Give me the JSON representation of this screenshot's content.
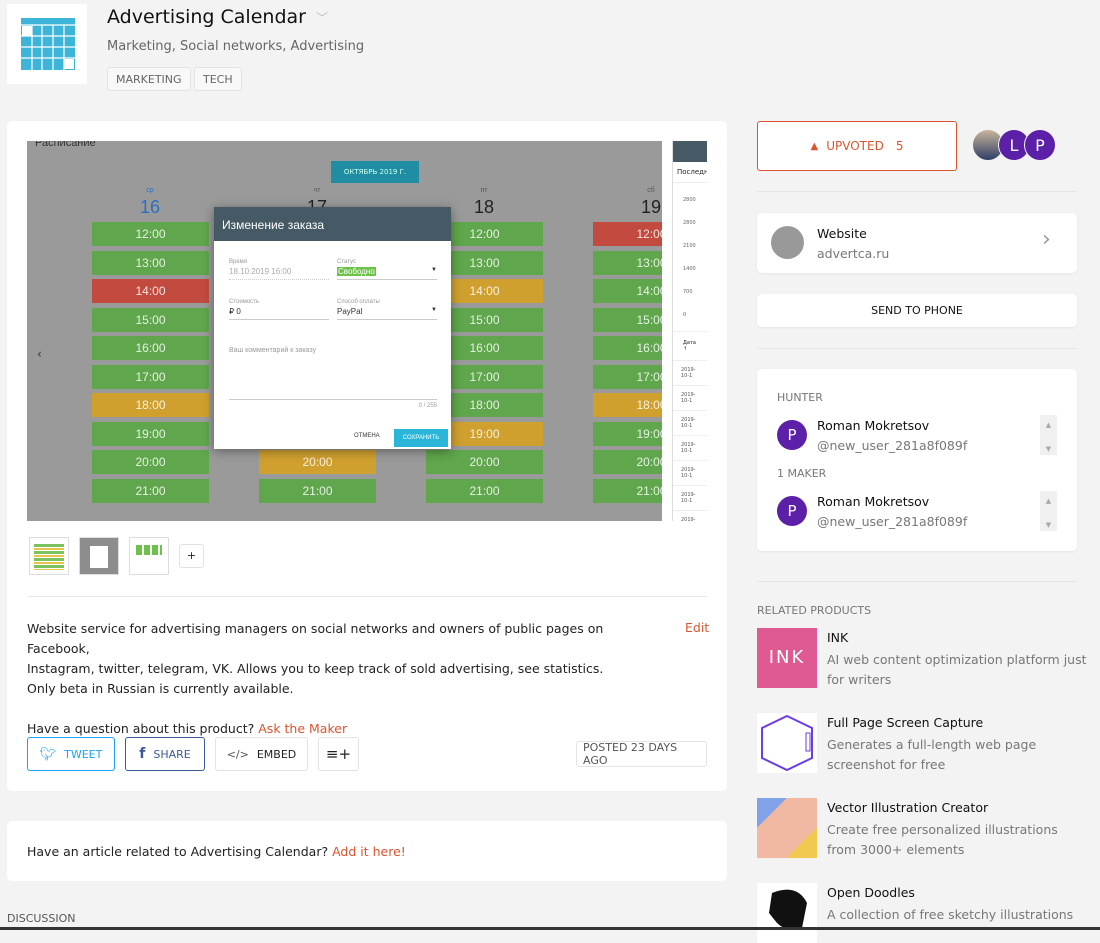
{
  "product": {
    "name": "Advertising Calendar",
    "categories": "Marketing, Social networks, Advertising",
    "tags": [
      "MARKETING",
      "TECH"
    ]
  },
  "gallery": {
    "heading": "Расписание",
    "month_button": "ОКТЯБРЬ 2019 Г.",
    "prev_arrow": "‹",
    "days": [
      {
        "name": "ср",
        "num": "16",
        "slots": [
          "green",
          "green",
          "red",
          "green",
          "green",
          "green",
          "yellow",
          "green",
          "green",
          "green"
        ]
      },
      {
        "name": "чт",
        "num": "17",
        "slots": [
          "green",
          "green",
          "green",
          "green",
          "green",
          "green",
          "green",
          "green",
          "yellow",
          "green"
        ]
      },
      {
        "name": "пт",
        "num": "18",
        "slots": [
          "green",
          "green",
          "yellow",
          "green",
          "green",
          "green",
          "green",
          "yellow",
          "green",
          "green"
        ]
      },
      {
        "name": "сб",
        "num": "19",
        "slots": [
          "red",
          "green",
          "green",
          "green",
          "green",
          "green",
          "yellow",
          "green",
          "green",
          "green"
        ]
      }
    ],
    "times": [
      "12:00",
      "13:00",
      "14:00",
      "15:00",
      "16:00",
      "17:00",
      "18:00",
      "19:00",
      "20:00",
      "21:00"
    ],
    "slot_colors": {
      "green": "#5fa64c",
      "red": "#c34a3f",
      "yellow": "#cfa02e"
    },
    "modal": {
      "title": "Изменение заказа",
      "time_label": "Время",
      "time_value": "18.10.2019 16:00",
      "status_label": "Статус",
      "status_value": "Свободно",
      "cost_label": "Стоимость",
      "cost_value": "₽ 0",
      "payment_label": "Способ оплаты",
      "payment_value": "PayPal",
      "comment_placeholder": "Ваш комментарий к заказу",
      "counter": "0 / 255",
      "cancel": "ОТМЕНА",
      "save": "СОХРАНИТЬ"
    },
    "side": {
      "tab": "Последн",
      "axis": [
        "2800",
        "2800",
        "2100",
        "1400",
        "700",
        "0"
      ],
      "col": "Дата ↑",
      "rows": [
        "2019-10-1",
        "2019-10-1",
        "2019-10-1",
        "2019-10-1",
        "2019-10-1",
        "2019-10-1",
        "2019-10-1"
      ]
    },
    "add_button": "+"
  },
  "description": {
    "text_lines": [
      "Website service for advertising managers on social networks and owners of public pages on Facebook,",
      "Instagram, twitter, telegram, VK. Allows you to keep track of sold advertising, see statistics.",
      "Only beta in Russian is currently available."
    ],
    "edit": "Edit",
    "question": "Have a question about this product?",
    "ask": "Ask the Maker"
  },
  "actions": {
    "tweet": "TWEET",
    "share": "SHARE",
    "embed": "EMBED",
    "posted": "POSTED 23 DAYS AGO"
  },
  "article": {
    "text": "Have an article related to Advertising Calendar?",
    "link": "Add it here!"
  },
  "discussion": "DISCUSSION",
  "sidebar": {
    "upvote_label": "UPVOTED",
    "upvote_count": "5",
    "voters": [
      "L",
      "P"
    ],
    "website": {
      "label": "Website",
      "url": "advertca.ru"
    },
    "send_to_phone": "SEND TO PHONE",
    "hunter_label": "HUNTER",
    "maker_label": "1 MAKER",
    "hunter": {
      "initial": "P",
      "name": "Roman Mokretsov",
      "user": "@new_user_281a8f089f"
    },
    "maker": {
      "initial": "P",
      "name": "Roman Mokretsov",
      "user": "@new_user_281a8f089f"
    },
    "related_label": "RELATED PRODUCTS",
    "related": [
      {
        "name": "INK",
        "desc": "AI web content optimization platform just for writers"
      },
      {
        "name": "Full Page Screen Capture",
        "desc": "Generates a full-length web page screenshot for free"
      },
      {
        "name": "Vector Illustration Creator",
        "desc": "Create free personalized illustrations from 3000+ elements"
      },
      {
        "name": "Open Doodles",
        "desc": "A collection of free sketchy illustrations"
      }
    ]
  },
  "colors": {
    "accent": "#da552f",
    "avatar": "#5b1fa8",
    "twitter": "#1da1f2",
    "facebook": "#3b5998"
  }
}
